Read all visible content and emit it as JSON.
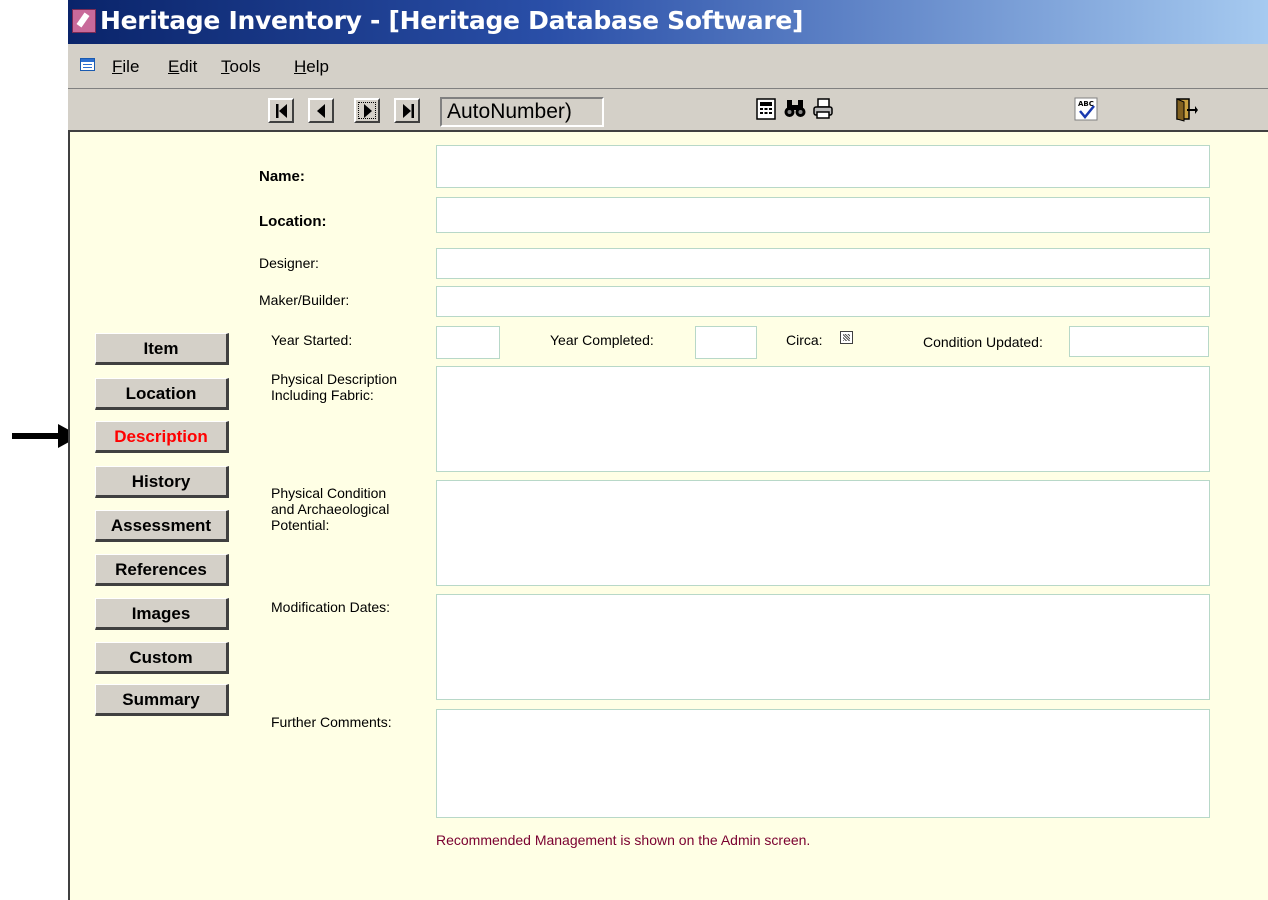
{
  "window": {
    "title": "Heritage Inventory - [Heritage Database Software]"
  },
  "menu": {
    "items": [
      "File",
      "Edit",
      "Tools",
      "Help"
    ]
  },
  "toolbar": {
    "record_number": "AutoNumber)"
  },
  "sidebar": {
    "items": [
      {
        "label": "Item"
      },
      {
        "label": "Location"
      },
      {
        "label": "Description",
        "active": true
      },
      {
        "label": "History"
      },
      {
        "label": "Assessment"
      },
      {
        "label": "References"
      },
      {
        "label": "Images"
      },
      {
        "label": "Custom"
      },
      {
        "label": "Summary"
      }
    ]
  },
  "form": {
    "name_label": "Name:",
    "name_value": "",
    "location_label": "Location:",
    "location_value": "",
    "designer_label": "Designer:",
    "designer_value": "",
    "maker_label": "Maker/Builder:",
    "maker_value": "",
    "year_started_label": "Year Started:",
    "year_started_value": "",
    "year_completed_label": "Year Completed:",
    "year_completed_value": "",
    "circa_label": "Circa:",
    "condition_updated_label": "Condition Updated:",
    "condition_updated_value": "",
    "physical_description_label": "Physical Description Including Fabric:",
    "physical_description_value": "",
    "physical_condition_label": "Physical Condition and Archaeological Potential:",
    "physical_condition_value": "",
    "modification_dates_label": "Modification Dates:",
    "modification_dates_value": "",
    "further_comments_label": "Further Comments:",
    "further_comments_value": "",
    "management_note": "Recommended Management is shown on the  Admin screen."
  },
  "colors": {
    "form_background": "#ffffe5",
    "active_tab_text": "#ff0000",
    "note_text": "#7a0030",
    "titlebar_start": "#0a246a",
    "titlebar_end": "#a6caf0"
  },
  "icons": [
    "access-app-icon",
    "form-view-icon",
    "first-record-icon",
    "previous-record-icon",
    "next-record-icon",
    "last-record-icon",
    "calculator-icon",
    "binoculars-icon",
    "printer-icon",
    "spellcheck-icon",
    "exit-door-icon",
    "pointer-arrow-icon"
  ]
}
